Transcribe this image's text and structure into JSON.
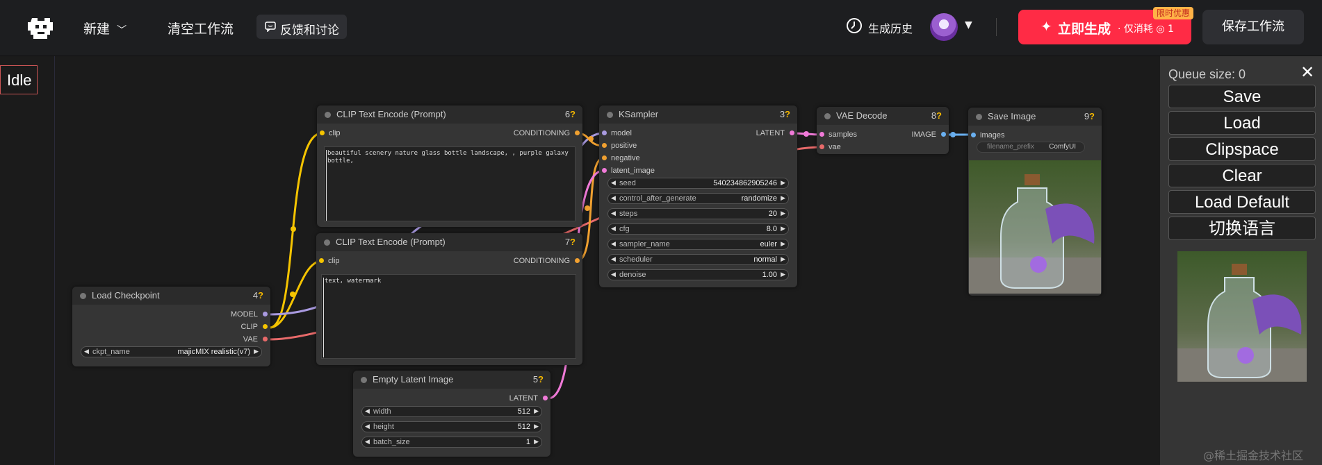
{
  "topbar": {
    "new_label": "新建",
    "clear_label": "清空工作流",
    "feedback_label": "反馈和讨论",
    "history_label": "生成历史",
    "generate_label": "立即生成",
    "generate_cost": "· 仅消耗 ◎ 1",
    "promo_badge": "限时优惠",
    "save_workflow_label": "保存工作流"
  },
  "status": "Idle",
  "nodes": {
    "clip_pos": {
      "title": "CLIP Text Encode (Prompt)",
      "id": "6",
      "input": "clip",
      "output": "CONDITIONING",
      "text": "beautiful scenery nature glass bottle landscape, , purple galaxy bottle,"
    },
    "clip_neg": {
      "title": "CLIP Text Encode (Prompt)",
      "id": "7",
      "input": "clip",
      "output": "CONDITIONING",
      "text": "text, watermark"
    },
    "ksampler": {
      "title": "KSampler",
      "id": "3",
      "inputs": [
        "model",
        "positive",
        "negative",
        "latent_image"
      ],
      "output": "LATENT",
      "widgets": [
        {
          "name": "seed",
          "value": "540234862905246"
        },
        {
          "name": "control_after_generate",
          "value": "randomize"
        },
        {
          "name": "steps",
          "value": "20"
        },
        {
          "name": "cfg",
          "value": "8.0"
        },
        {
          "name": "sampler_name",
          "value": "euler"
        },
        {
          "name": "scheduler",
          "value": "normal"
        },
        {
          "name": "denoise",
          "value": "1.00"
        }
      ]
    },
    "vae_decode": {
      "title": "VAE Decode",
      "id": "8",
      "inputs": [
        "samples",
        "vae"
      ],
      "output": "IMAGE"
    },
    "save_image": {
      "title": "Save Image",
      "id": "9",
      "input": "images",
      "prefix_name": "filename_prefix",
      "prefix_value": "ComfyUI"
    },
    "checkpoint": {
      "title": "Load Checkpoint",
      "id": "4",
      "outputs": [
        "MODEL",
        "CLIP",
        "VAE"
      ],
      "widget_name": "ckpt_name",
      "widget_value": "majicMIX realistic(v7)"
    },
    "latent": {
      "title": "Empty Latent Image",
      "id": "5",
      "output": "LATENT",
      "widgets": [
        {
          "name": "width",
          "value": "512"
        },
        {
          "name": "height",
          "value": "512"
        },
        {
          "name": "batch_size",
          "value": "1"
        }
      ]
    }
  },
  "sidebar": {
    "queue_size": "Queue size: 0",
    "close": "✕",
    "buttons": [
      "Save",
      "Load",
      "Clipspace",
      "Clear",
      "Load Default",
      "切换语言"
    ]
  },
  "watermark": "@稀土掘金技术社区",
  "colors": {
    "accent": "#ff2b45",
    "link_yellow": "#f5c400",
    "link_orange": "#f0a030",
    "link_pink": "#f07ad8",
    "link_lavender": "#a99ae0",
    "link_red": "#e86a6a",
    "link_blue": "#6ab0f0"
  }
}
